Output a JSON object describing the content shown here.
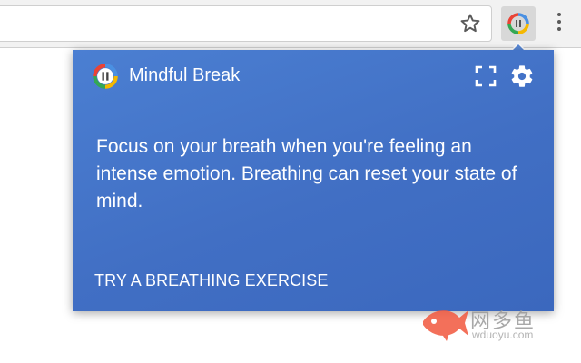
{
  "browser": {
    "star_icon": "star-icon",
    "extension_icon": "mindful-break-logo-icon",
    "menu_icon": "vertical-dots-icon"
  },
  "popup": {
    "app_title": "Mindful Break",
    "logo_icon": "mindful-break-logo-icon",
    "fullscreen_icon": "fullscreen-icon",
    "settings_icon": "gear-icon",
    "message": "Focus on your breath when you're feeling an intense emotion. Breathing can reset your state of mind.",
    "cta_label": "TRY A BREATHING EXERCISE",
    "background_color": "#4577c8"
  },
  "watermark": {
    "cn_text": "网多鱼",
    "en_text": "wduoyu.com",
    "fish_color": "#f2583e"
  }
}
